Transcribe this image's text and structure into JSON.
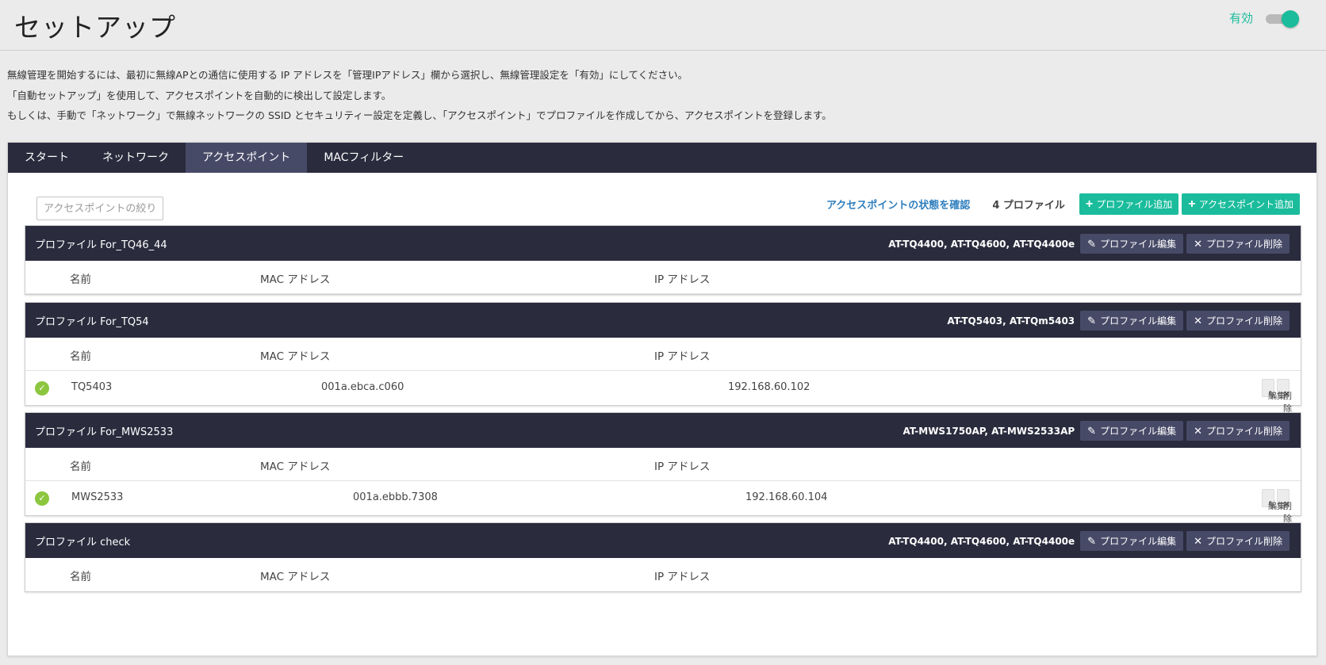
{
  "header": {
    "title": "セットアップ",
    "enable_label": "有効",
    "enabled": true
  },
  "description": [
    "無線管理を開始するには、最初に無線APとの通信に使用する IP アドレスを「管理IPアドレス」欄から選択し、無線管理設定を「有効」にしてください。",
    "「自動セットアップ」を使用して、アクセスポイントを自動的に検出して設定します。",
    "もしくは、手動で「ネットワーク」で無線ネットワークの SSID とセキュリティー設定を定義し、「アクセスポイント」でプロファイルを作成してから、アクセスポイントを登録します。"
  ],
  "tabs": [
    {
      "label": "スタート",
      "active": false
    },
    {
      "label": "ネットワーク",
      "active": false
    },
    {
      "label": "アクセスポイント",
      "active": true
    },
    {
      "label": "MACフィルター",
      "active": false
    }
  ],
  "toolbar": {
    "filter_placeholder": "アクセスポイントの絞り込み",
    "status_link": "アクセスポイントの状態を確認",
    "profile_count": "4 プロファイル",
    "add_profile": "プロファイル追加",
    "add_ap": "アクセスポイント追加"
  },
  "columns": {
    "name": "名前",
    "mac": "MAC アドレス",
    "ip": "IP アドレス"
  },
  "buttons": {
    "edit_profile": "プロファイル編集",
    "delete_profile": "プロファイル削除",
    "edit": "編集",
    "delete": "削除"
  },
  "profiles": [
    {
      "name": "プロファイル For_TQ46_44",
      "models": "AT-TQ4400, AT-TQ4600, AT-TQ4400e",
      "aps": []
    },
    {
      "name": "プロファイル For_TQ54",
      "models": "AT-TQ5403, AT-TQm5403",
      "aps": [
        {
          "name": "TQ5403",
          "mac": "001a.ebca.c060",
          "ip": "192.168.60.102"
        }
      ]
    },
    {
      "name": "プロファイル For_MWS2533",
      "models": "AT-MWS1750AP, AT-MWS2533AP",
      "aps": [
        {
          "name": "MWS2533",
          "mac": "001a.ebbb.7308",
          "ip": "192.168.60.104"
        }
      ]
    },
    {
      "name": "プロファイル check",
      "models": "AT-TQ4400, AT-TQ4600, AT-TQ4400e",
      "aps": []
    }
  ],
  "colors": {
    "accent": "#1abc9c",
    "header_dark": "#2a2b3d",
    "tab_active": "#474a67",
    "link": "#2f7fbe",
    "ok": "#8cc63f"
  }
}
